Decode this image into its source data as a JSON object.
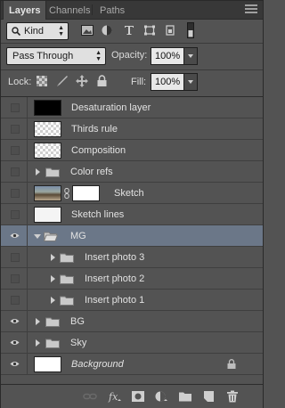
{
  "tabs": [
    {
      "label": "Layers",
      "active": true
    },
    {
      "label": "Channels",
      "active": false
    },
    {
      "label": "Paths",
      "active": false
    }
  ],
  "filter": {
    "kind_label": "Kind",
    "icons": [
      "image-filter-icon",
      "adjustment-filter-icon",
      "type-filter-icon",
      "shape-filter-icon",
      "smart-object-filter-icon",
      "filter-toggle-icon"
    ]
  },
  "blend": {
    "mode": "Pass Through"
  },
  "opacity": {
    "label": "Opacity:",
    "value": "100%"
  },
  "lock": {
    "label": "Lock:",
    "icons": [
      "lock-transparent-icon",
      "lock-image-icon",
      "lock-position-icon",
      "lock-all-icon"
    ]
  },
  "fill": {
    "label": "Fill:",
    "value": "100%"
  },
  "layers": [
    {
      "name": "Desaturation layer",
      "visible": false,
      "type": "layer",
      "thumb": "black"
    },
    {
      "name": "Thirds rule",
      "visible": false,
      "type": "layer",
      "thumb": "check"
    },
    {
      "name": "Composition",
      "visible": false,
      "type": "layer",
      "thumb": "check"
    },
    {
      "name": "Color refs",
      "visible": false,
      "type": "group",
      "open": false,
      "indent": 0
    },
    {
      "name": "Sketch",
      "visible": false,
      "type": "masked",
      "thumb": "photo"
    },
    {
      "name": "Sketch lines",
      "visible": false,
      "type": "layer",
      "thumb": "lines"
    },
    {
      "name": "MG",
      "visible": true,
      "type": "group",
      "open": true,
      "indent": 0,
      "selected": true
    },
    {
      "name": "Insert photo 3",
      "visible": false,
      "type": "group",
      "open": false,
      "indent": 1
    },
    {
      "name": "Insert photo 2",
      "visible": false,
      "type": "group",
      "open": false,
      "indent": 1
    },
    {
      "name": "Insert photo 1",
      "visible": false,
      "type": "group",
      "open": false,
      "indent": 1
    },
    {
      "name": "BG",
      "visible": true,
      "type": "group",
      "open": false,
      "indent": 0
    },
    {
      "name": "Sky",
      "visible": true,
      "type": "group",
      "open": false,
      "indent": 0
    },
    {
      "name": "Background",
      "visible": true,
      "type": "background",
      "thumb": "white",
      "locked": true
    }
  ],
  "footer_icons": [
    "link-layers-icon",
    "fx-icon",
    "add-mask-icon",
    "adjustment-layer-icon",
    "new-group-icon",
    "new-layer-icon",
    "delete-layer-icon"
  ],
  "colors": {
    "selection": "#6b7788",
    "panel": "#535353",
    "tabbar": "#383838"
  }
}
